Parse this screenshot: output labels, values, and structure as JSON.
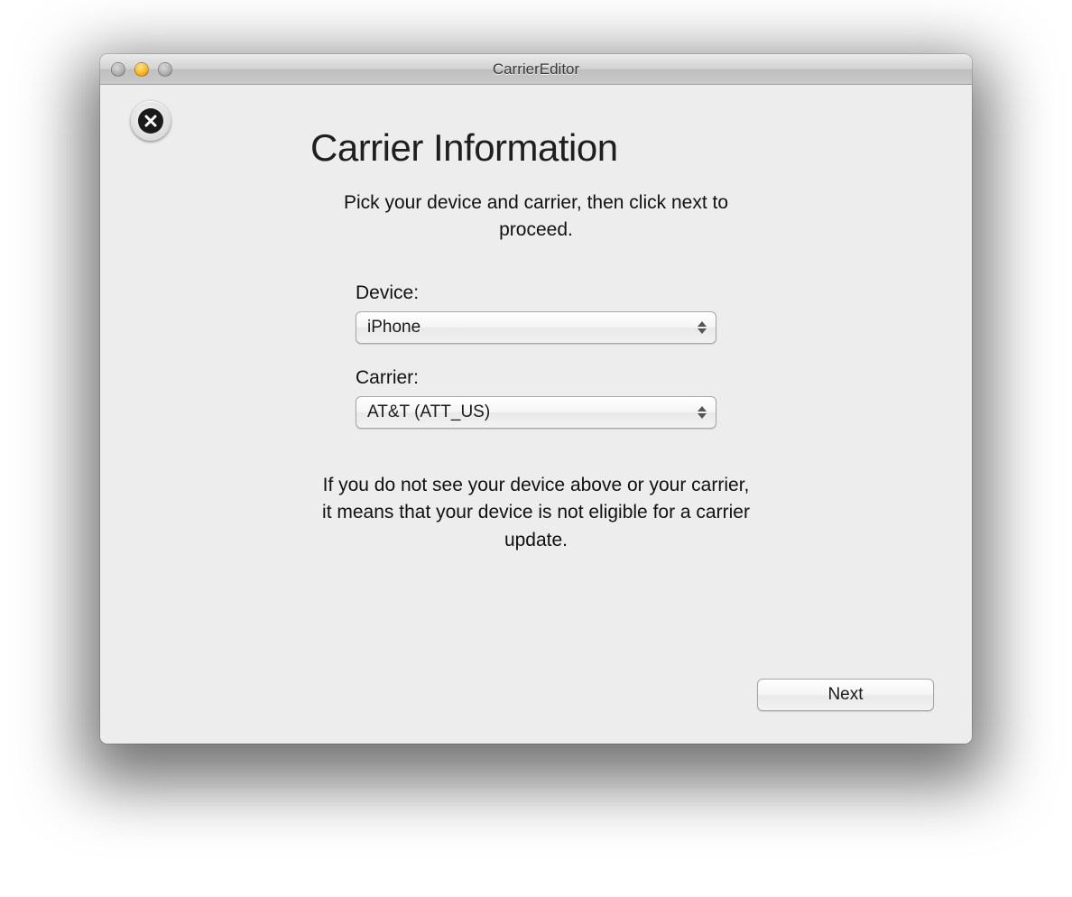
{
  "window": {
    "title": "CarrierEditor"
  },
  "icons": {
    "close_badge": "close-icon"
  },
  "page": {
    "heading": "Carrier Information",
    "subtitle": "Pick your device and carrier, then click next to proceed.",
    "hint": "If you do not see your device above or your carrier, it means that your device is not eligible for a carrier update."
  },
  "form": {
    "device": {
      "label": "Device:",
      "value": "iPhone"
    },
    "carrier": {
      "label": "Carrier:",
      "value": "AT&T (ATT_US)"
    }
  },
  "buttons": {
    "next": "Next"
  }
}
